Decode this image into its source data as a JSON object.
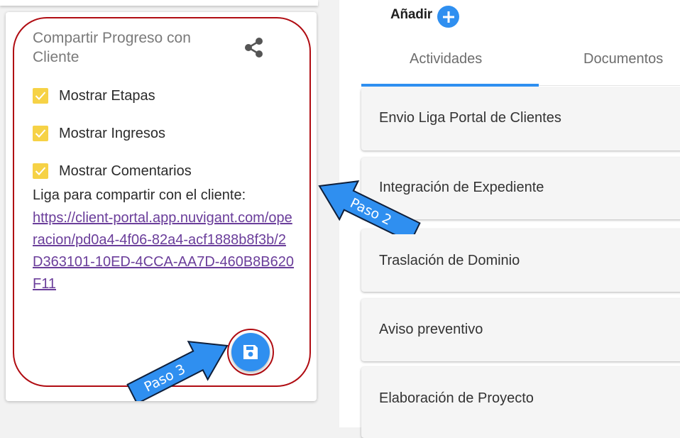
{
  "share_panel": {
    "title": "Compartir Progreso con Cliente",
    "share_icon": "share-icon",
    "options": [
      {
        "label": "Mostrar Etapas",
        "checked": true
      },
      {
        "label": "Mostrar Ingresos",
        "checked": true
      },
      {
        "label": "Mostrar Comentarios",
        "checked": true
      }
    ],
    "link_caption": "Liga para compartir con el cliente:",
    "link_url": "https://client-portal.app.nuvigant.com/operacion/pd0a4-4f06-82a4-acf1888b8f3b/2D363101-10ED-4CCA-AA7D-460B8B620F11",
    "save_icon": "floppy-disk-icon"
  },
  "toolbar": {
    "add_label": "Añadir",
    "add_icon": "plus-icon"
  },
  "tabs": [
    {
      "label": "Actividades",
      "active": true
    },
    {
      "label": "Documentos",
      "active": false
    }
  ],
  "activities": [
    {
      "label": "Envio Liga Portal de Clientes"
    },
    {
      "label": "Integración de Expediente"
    },
    {
      "label": "Traslación de Dominio"
    },
    {
      "label": "Aviso preventivo"
    },
    {
      "label": "Elaboración de Proyecto"
    }
  ],
  "annotations": {
    "step2": "Paso 2",
    "step3": "Paso 3"
  },
  "colors": {
    "accent_blue": "#2f8ff0",
    "checkbox_yellow": "#f6d246",
    "highlight_red": "#b00c12",
    "link_purple": "#6a3d9a"
  }
}
